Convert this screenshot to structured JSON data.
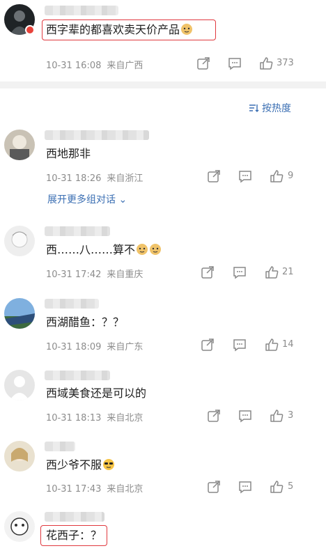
{
  "post": {
    "text": "西字辈的都喜欢卖天价产品",
    "time": "10-31 16:08",
    "source": "来自广西",
    "likes": "373"
  },
  "sort_label": "按热度",
  "comments": [
    {
      "text": "西地那非",
      "time": "10-31 18:26",
      "source": "来自浙江",
      "likes": "9",
      "expand": "展开更多组对话"
    },
    {
      "text": "西……八……算不",
      "time": "10-31 17:42",
      "source": "来自重庆",
      "likes": "21"
    },
    {
      "text": "西湖醋鱼：？？",
      "time": "10-31 18:09",
      "source": "来自广东",
      "likes": "14"
    },
    {
      "text": "西域美食还是可以的",
      "time": "10-31 18:13",
      "source": "来自北京",
      "likes": "3"
    },
    {
      "text": "西少爷不服",
      "time": "10-31 17:43",
      "source": "来自北京",
      "likes": "5"
    },
    {
      "text": "花西子：？"
    }
  ],
  "icons": {
    "share": "share-icon",
    "comment": "comment-icon",
    "like": "like-icon",
    "sort": "sort-icon"
  },
  "colors": {
    "link": "#3b6fb3",
    "highlight": "#e0383e",
    "meta": "#8c8c8c"
  }
}
